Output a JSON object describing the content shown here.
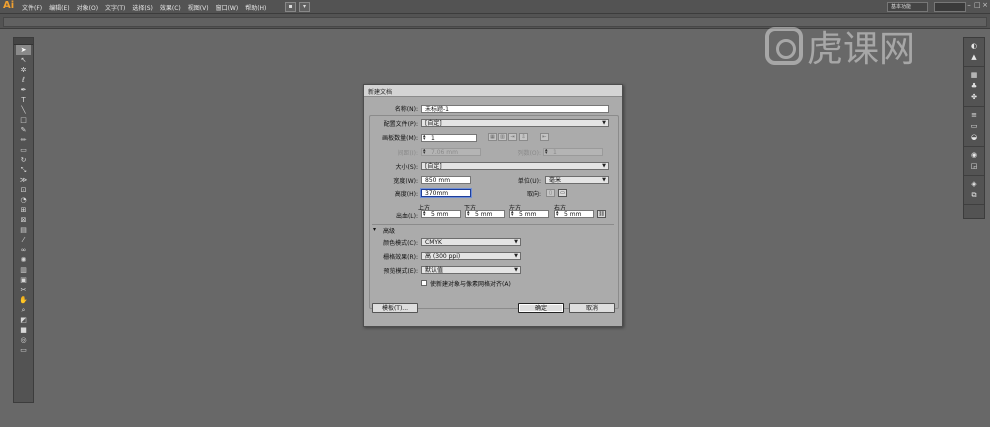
{
  "app": {
    "logo": "Ai"
  },
  "menubar": {
    "items": [
      "文件(F)",
      "编辑(E)",
      "对象(O)",
      "文字(T)",
      "选择(S)",
      "效果(C)",
      "视图(V)",
      "窗口(W)",
      "帮助(H)"
    ],
    "workspace": "基本功能",
    "window_buttons": [
      "–",
      "□",
      "×"
    ]
  },
  "watermark": {
    "text": "虎课网"
  },
  "dialog": {
    "title": "新建文档",
    "name_label": "名称(N):",
    "name_value": "未标题-1",
    "profile_label": "配置文件(P):",
    "profile_value": "[自定]",
    "artboards_label": "画板数量(M):",
    "artboards_value": "1",
    "spacing_label": "间距(I):",
    "spacing_value": "7.06 mm",
    "columns_label": "列数(O):",
    "columns_value": "1",
    "size_label": "大小(S):",
    "size_value": "[自定]",
    "width_label": "宽度(W):",
    "width_value": "850 mm",
    "units_label": "单位(U):",
    "units_value": "毫米",
    "height_label": "高度(H):",
    "height_value": "370mm",
    "orientation_label": "取向:",
    "bleed_label": "出血(L):",
    "bleed_top_label": "上方",
    "bleed_bottom_label": "下方",
    "bleed_left_label": "左方",
    "bleed_right_label": "右方",
    "bleed_top": "5 mm",
    "bleed_bottom": "5 mm",
    "bleed_left": "5 mm",
    "bleed_right": "5 mm",
    "advanced_label": "高级",
    "color_mode_label": "颜色模式(C):",
    "color_mode_value": "CMYK",
    "raster_label": "栅格效果(R):",
    "raster_value": "高 (300 ppi)",
    "preview_label": "预览模式(E):",
    "preview_value": "默认值",
    "align_pixel_label": "使新建对象与像素网格对齐(A)",
    "templates_button": "模板(T)...",
    "ok_button": "确定",
    "cancel_button": "取消"
  }
}
